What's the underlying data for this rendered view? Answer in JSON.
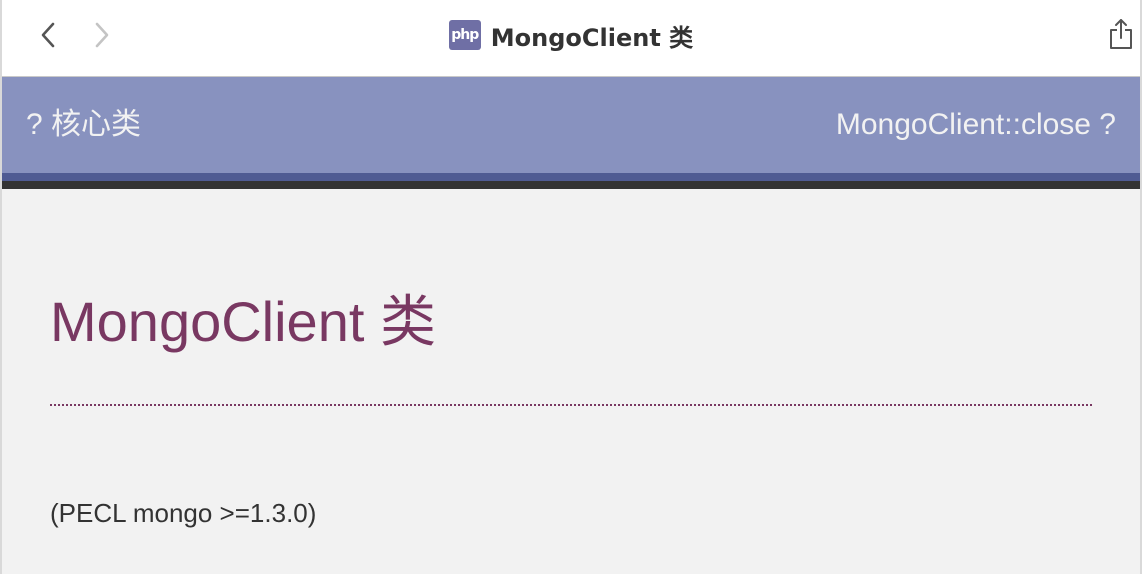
{
  "titlebar": {
    "title": "MongoClient 类",
    "logo_text": "php",
    "back_icon": "chevron-left-icon",
    "forward_icon": "chevron-right-icon",
    "share_icon": "share-icon"
  },
  "manual_nav": {
    "prev_label": "? 核心类",
    "next_label": "MongoClient::close ?"
  },
  "page": {
    "title": "MongoClient 类",
    "version_info": "(PECL mongo >=1.3.0)"
  },
  "colors": {
    "nav_bg": "#8892bf",
    "title_color": "#793862",
    "php_logo": "#6f6fa5",
    "stripe_blue": "#4f5b93",
    "stripe_dark": "#333333",
    "page_bg": "#f2f2f2"
  }
}
